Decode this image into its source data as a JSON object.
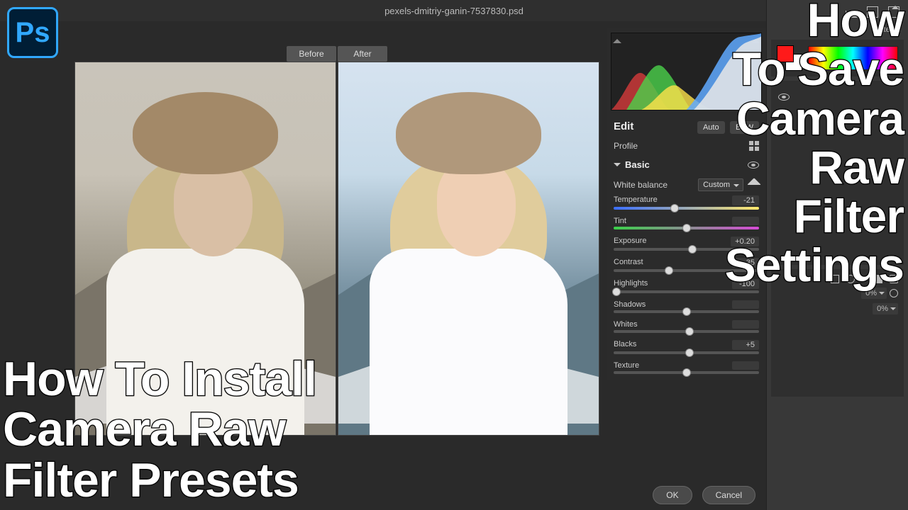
{
  "topbar": {
    "filename": "pexels-dmitriy-ganin-7537830.psd"
  },
  "app_logo": "Ps",
  "compare": {
    "before_label": "Before",
    "after_label": "After"
  },
  "edit_panel": {
    "title": "Edit",
    "auto_label": "Auto",
    "bw_label": "B&W",
    "profile_label": "Profile",
    "basic_label": "Basic",
    "wb_label": "White balance",
    "wb_value": "Custom",
    "sliders": [
      {
        "name": "Temperature",
        "value": "-21",
        "thumb": 42,
        "track": "temp"
      },
      {
        "name": "Tint",
        "value": "",
        "thumb": 50,
        "track": "tint"
      },
      {
        "name": "Exposure",
        "value": "+0.20",
        "thumb": 54,
        "track": ""
      },
      {
        "name": "Contrast",
        "value": "-35",
        "thumb": 38,
        "track": ""
      },
      {
        "name": "Highlights",
        "value": "-100",
        "thumb": 2,
        "track": ""
      },
      {
        "name": "Shadows",
        "value": "",
        "thumb": 50,
        "track": ""
      },
      {
        "name": "Whites",
        "value": "",
        "thumb": 52,
        "track": ""
      },
      {
        "name": "Blacks",
        "value": "+5",
        "thumb": 52,
        "track": ""
      },
      {
        "name": "Texture",
        "value": "",
        "thumb": 50,
        "track": ""
      }
    ]
  },
  "footer": {
    "ok": "OK",
    "cancel": "Cancel"
  },
  "ps_panels": {
    "tab_label": "Patterns",
    "layers": {
      "opacity_label": "0%",
      "fill_label": "0%"
    }
  },
  "headlines": {
    "left": "How To Install\nCamera Raw\nFilter Presets",
    "right": "How\nTo Save\nCamera\nRaw\nFilter\nSettings"
  }
}
